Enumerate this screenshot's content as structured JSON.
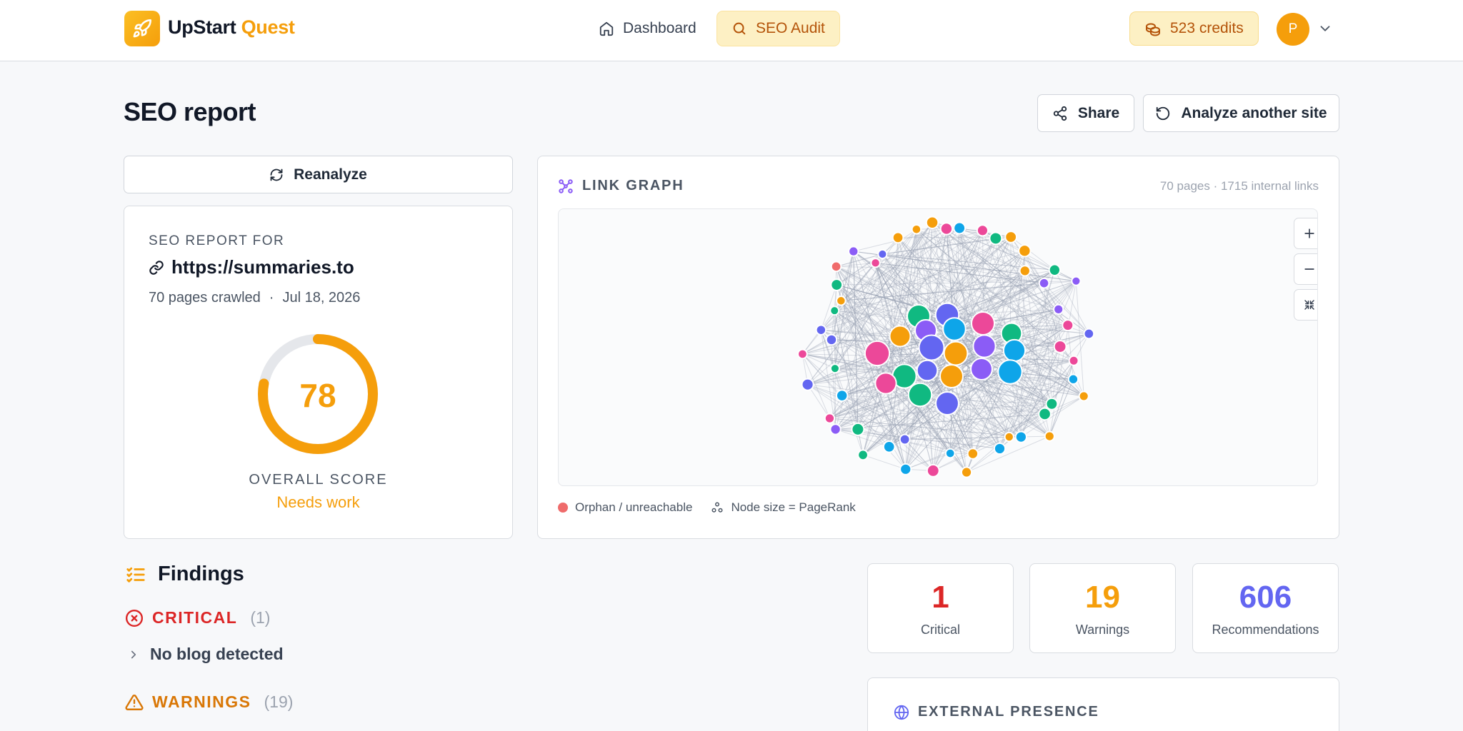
{
  "brand": {
    "name_main": "UpStart",
    "name_accent": "Quest"
  },
  "nav": {
    "dashboard": "Dashboard",
    "seo_audit": "SEO Audit"
  },
  "credits": "523 credits",
  "user": {
    "initial": "P"
  },
  "header": {
    "title": "SEO report",
    "share": "Share",
    "analyze_another": "Analyze another site"
  },
  "reanalyze": "Reanalyze",
  "report": {
    "for_label": "SEO REPORT FOR",
    "url": "https://summaries.to",
    "pages_crawled": "70 pages crawled",
    "separator": "·",
    "date": "Jul 18, 2026",
    "score": 78,
    "score_max": 100,
    "overall_label": "OVERALL SCORE",
    "status": "Needs work"
  },
  "link_graph": {
    "title": "LINK GRAPH",
    "stats": "70 pages · 1715 internal links",
    "legend_orphan": "Orphan / unreachable",
    "legend_size": "Node size = PageRank",
    "palette": [
      "#10b981",
      "#6366f1",
      "#f59e0b",
      "#8b5cf6",
      "#0ea5e9",
      "#ec4899",
      "#f06b6b"
    ]
  },
  "findings": {
    "title": "Findings",
    "critical_label": "CRITICAL",
    "critical_count": "(1)",
    "critical_item": "No blog detected",
    "warnings_label": "WARNINGS",
    "warnings_count": "(19)"
  },
  "stats": {
    "critical": {
      "value": "1",
      "label": "Critical"
    },
    "warnings": {
      "value": "19",
      "label": "Warnings"
    },
    "recommendations": {
      "value": "606",
      "label": "Recommendations"
    }
  },
  "external": {
    "title": "EXTERNAL PRESENCE"
  },
  "colors": {
    "accent": "#f59e0b",
    "critical": "#dc2626",
    "recommend": "#6366f1"
  }
}
